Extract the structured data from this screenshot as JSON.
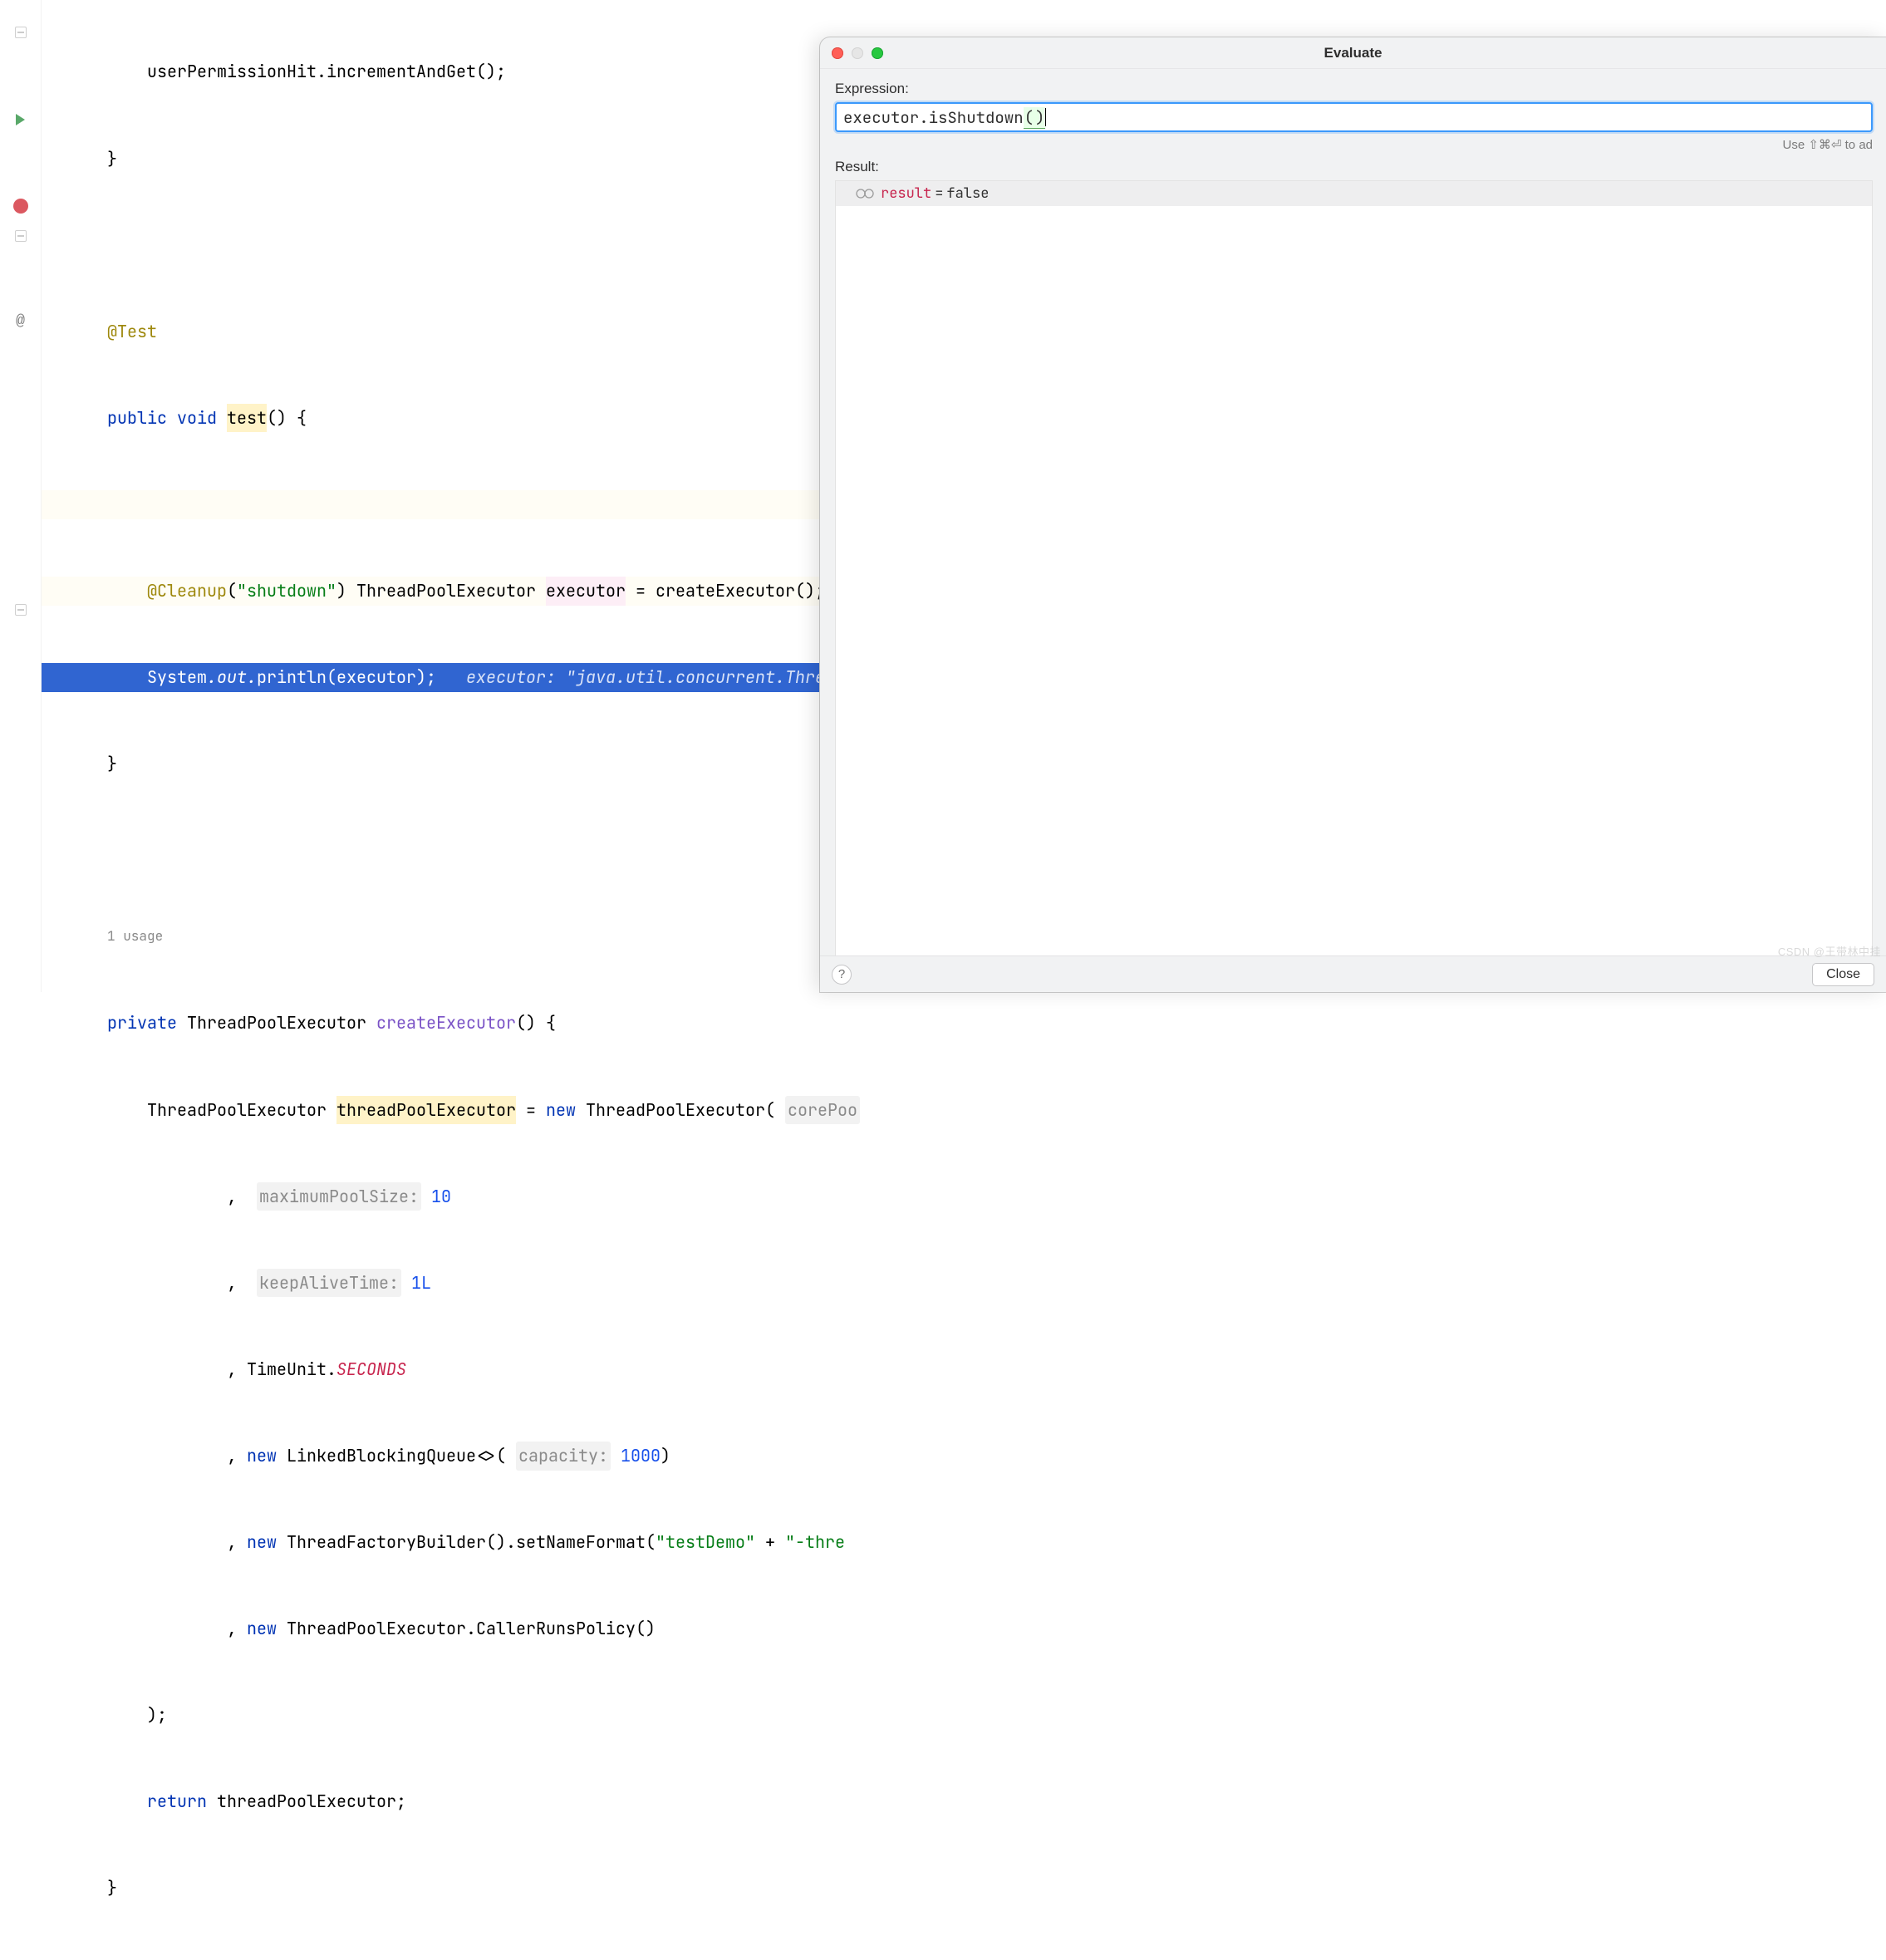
{
  "code": {
    "line1_call": "userPermissionHit.incrementAndGet();",
    "close_brace": "}",
    "test_annotation": "@Test",
    "kw_public": "public",
    "kw_void": "void",
    "fn_test": "test",
    "paren_brace": "() {",
    "cleanup_annotation": "@Cleanup",
    "cleanup_arg": "\"shutdown\"",
    "type_tpe": "ThreadPoolExecutor",
    "var_executor": "executor",
    "eq": " = ",
    "fn_createExecutor_call": "createExecutor();",
    "sys": "System",
    "out": ".out.",
    "println": "println",
    "exec_arg": "(executor);",
    "inlay_exec": "executor: \"java.util.concurrent.Thread",
    "usages": "1 usage",
    "kw_private": "private",
    "fn_createExecutor": "createExecutor",
    "paren_brace2": "() {",
    "var_tpe": "threadPoolExecutor",
    "kw_new": "new",
    "ctor_open": "ThreadPoolExecutor(",
    "p_core": "corePoo",
    "p_max": "maximumPoolSize:",
    "v_max": "10",
    "p_keep": "keepAliveTime:",
    "v_keep": "1L",
    "tu": "TimeUnit.",
    "seconds": "SECONDS",
    "lbq": "LinkedBlockingQueue<>(",
    "p_cap": "capacity:",
    "v_cap": "1000",
    "tfb": "ThreadFactoryBuilder().setNameFormat(",
    "s_demo": "\"testDemo\"",
    "plus": " + ",
    "s_thre": "\"-thre",
    "crp": "ThreadPoolExecutor.CallerRunsPolicy()",
    "stmt_end": ");",
    "kw_return": "return",
    "ret_expr": "threadPoolExecutor;"
  },
  "dialog": {
    "title": "Evaluate",
    "expression_label": "Expression:",
    "expression_value": "executor.isShutdown()",
    "tip_prefix": "Use ",
    "tip_keys": "⇧⌘⏎",
    "tip_suffix": " to ad",
    "result_label": "Result:",
    "result_name": "result",
    "result_value": "false",
    "close_label": "Close",
    "help_label": "?"
  },
  "watermark": "CSDN @王带林中挂"
}
